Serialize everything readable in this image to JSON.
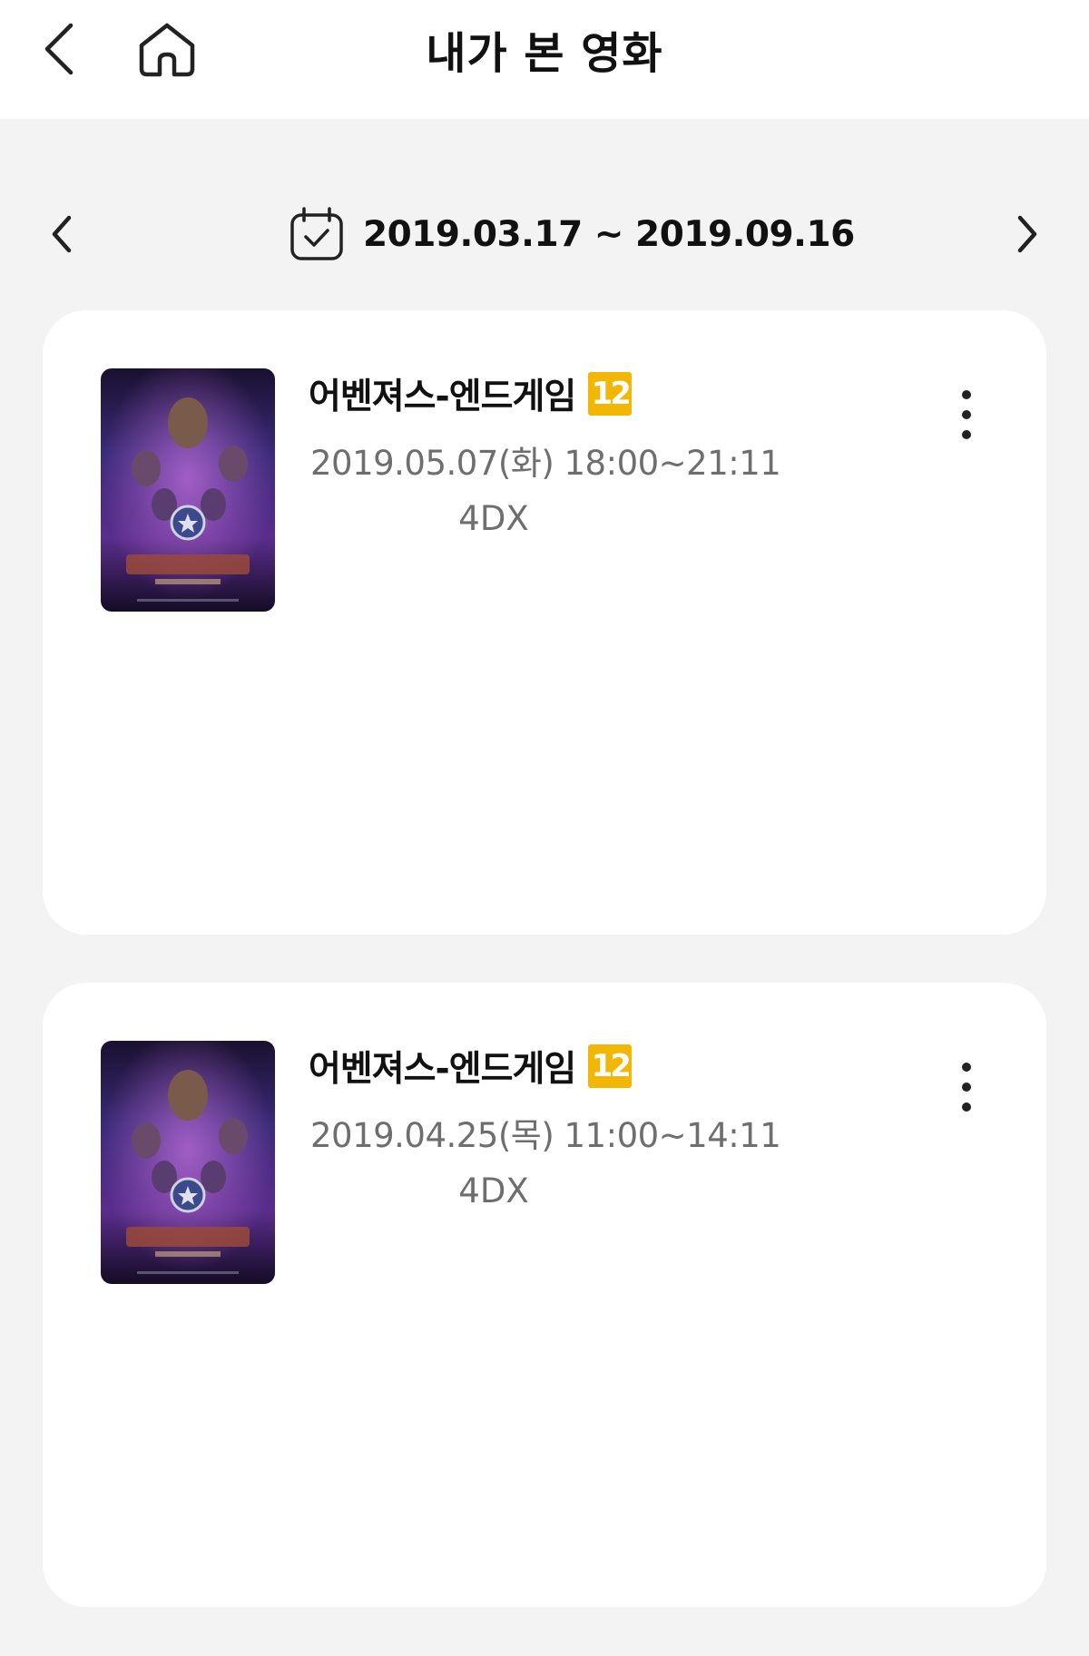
{
  "header": {
    "title": "내가 본 영화",
    "back_icon": "chevron-left-icon",
    "home_icon": "home-icon"
  },
  "range": {
    "text": "2019.03.17 ~ 2019.09.16",
    "calendar_icon": "calendar-check-icon",
    "prev_icon": "chevron-left-icon",
    "next_icon": "chevron-right-icon"
  },
  "movies": [
    {
      "title": "어벤져스-엔드게임",
      "rating": "12",
      "datetime": "2019.05.07(화) 18:00~21:11",
      "format": "4DX"
    },
    {
      "title": "어벤져스-엔드게임",
      "rating": "12",
      "datetime": "2019.04.25(목) 11:00~14:11",
      "format": "4DX"
    }
  ],
  "colors": {
    "background": "#f3f3f3",
    "card": "#ffffff",
    "rating_badge": "#f2b705",
    "secondary_text": "#6e6e6e"
  }
}
